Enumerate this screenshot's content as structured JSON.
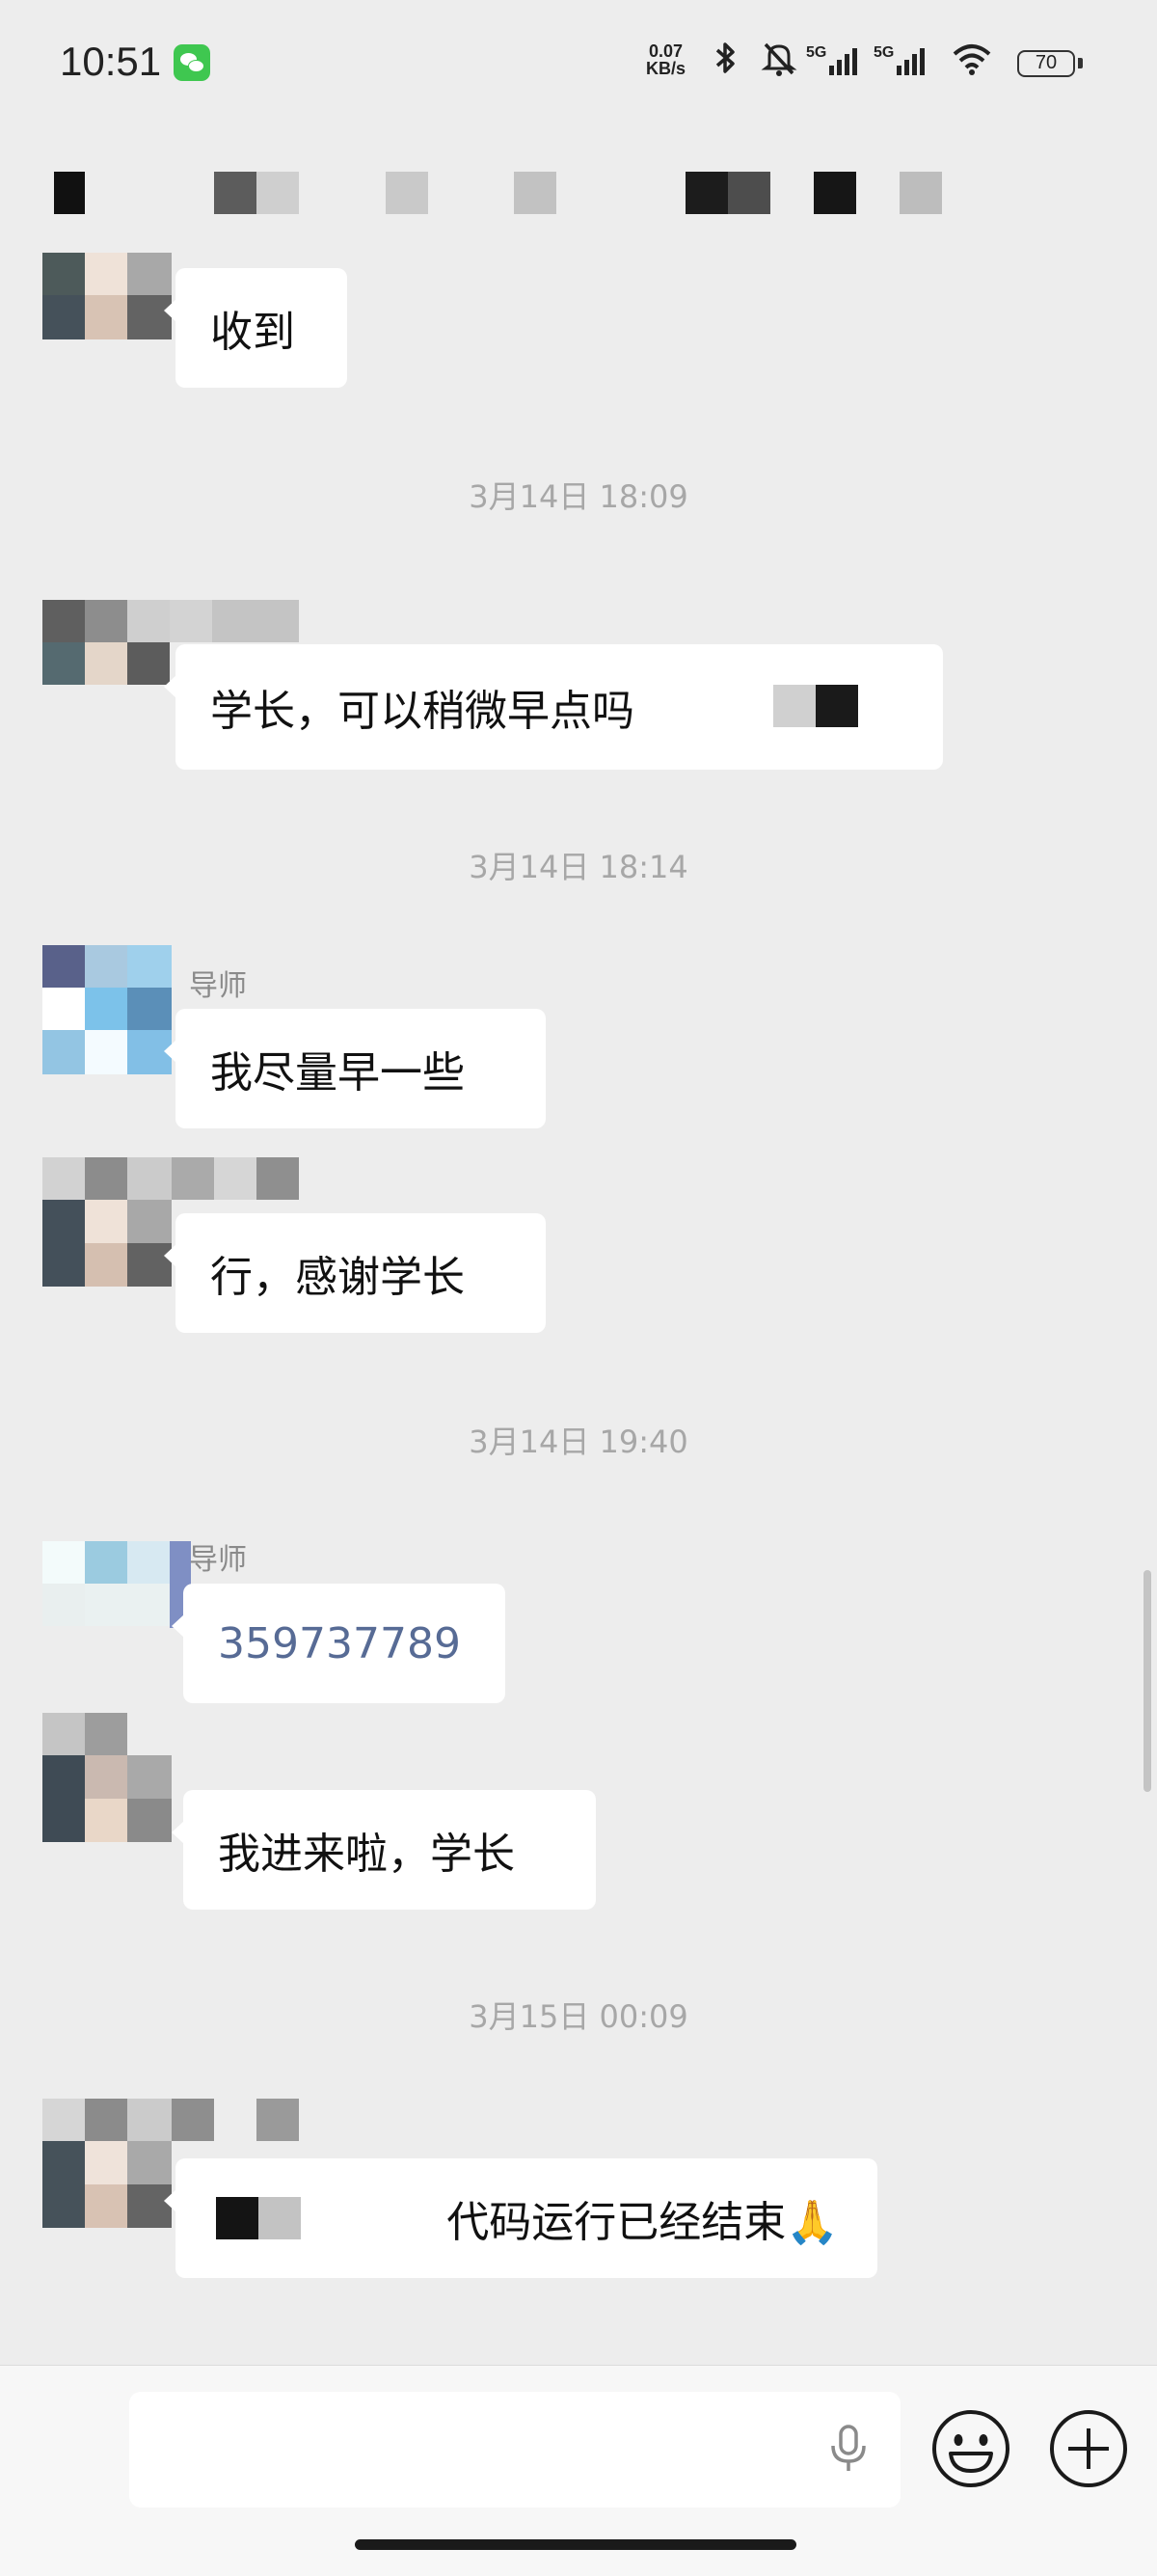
{
  "status_bar": {
    "time": "10:51",
    "net_speed_top": "0.07",
    "net_speed_bottom": "KB/s",
    "sim1": "5G",
    "sim2": "5G",
    "battery": "70"
  },
  "chat": {
    "messages": [
      {
        "text": "收到"
      },
      {
        "timestamp": "3月14日 18:09"
      },
      {
        "text": "学长，可以稍微早点吗"
      },
      {
        "timestamp": "3月14日 18:14"
      },
      {
        "sender": "导师",
        "text": "我尽量早一些"
      },
      {
        "text": "行，感谢学长"
      },
      {
        "timestamp": "3月14日 19:40"
      },
      {
        "sender": "导师",
        "text": "359737789"
      },
      {
        "text": "我进来啦，学长"
      },
      {
        "timestamp": "3月15日 00:09"
      },
      {
        "text": "代码运行已经结束🙏"
      }
    ]
  },
  "icons": {
    "voice": "microphone-icon",
    "emoji": "emoji-icon",
    "more": "plus-circle-icon"
  },
  "colors": {
    "background": "#ededed",
    "bubble": "#ffffff",
    "link_text": "#576b95",
    "timestamp": "#a7a7a7",
    "wechat_green": "#3fc750"
  }
}
